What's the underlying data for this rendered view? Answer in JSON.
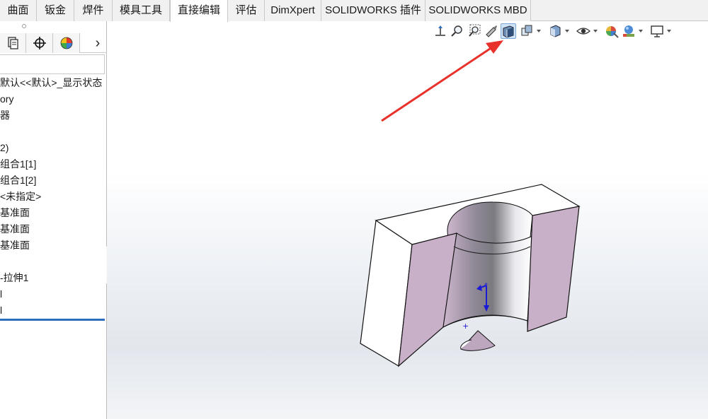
{
  "command_tabs": [
    {
      "label": "曲面",
      "active": false
    },
    {
      "label": "钣金",
      "active": false
    },
    {
      "label": "焊件",
      "active": false
    },
    {
      "label": "模具工具",
      "active": false
    },
    {
      "label": "直接编辑",
      "active": true
    },
    {
      "label": "评估",
      "active": false
    },
    {
      "label": "DimXpert",
      "active": false
    },
    {
      "label": "SOLIDWORKS 插件",
      "active": false
    },
    {
      "label": "SOLIDWORKS MBD",
      "active": false
    }
  ],
  "manager_tabs": [
    {
      "icon": "property-manager-icon"
    },
    {
      "icon": "dimxpert-manager-icon"
    },
    {
      "icon": "display-manager-icon"
    }
  ],
  "manager_more_glyph": "›",
  "feature_tree": {
    "items": [
      "默认<<默认>_显示状态",
      "ory",
      "器",
      "2)",
      "组合1[1]",
      "组合1[2]",
      "<未指定>",
      "基准面",
      "基准面",
      "基准面",
      "-拉伸1",
      "l",
      "l"
    ]
  },
  "heads_up_toolbar": {
    "icons": [
      "view-orientation-icon",
      "zoom-to-fit-icon",
      "zoom-to-area-icon",
      "previous-view-icon",
      "section-view-icon",
      "view-orientation-dropdown-icon",
      "display-style-icon",
      "hide-show-items-icon",
      "edit-appearance-icon",
      "apply-scene-icon",
      "view-settings-icon"
    ],
    "active_icon": "section-view-icon"
  },
  "colors": {
    "accent": "#2c6fbe",
    "annotation_arrow": "#e8312b",
    "section_face": "#c8b0c8",
    "model_face": "#ffffff",
    "model_edge": "#111111"
  }
}
